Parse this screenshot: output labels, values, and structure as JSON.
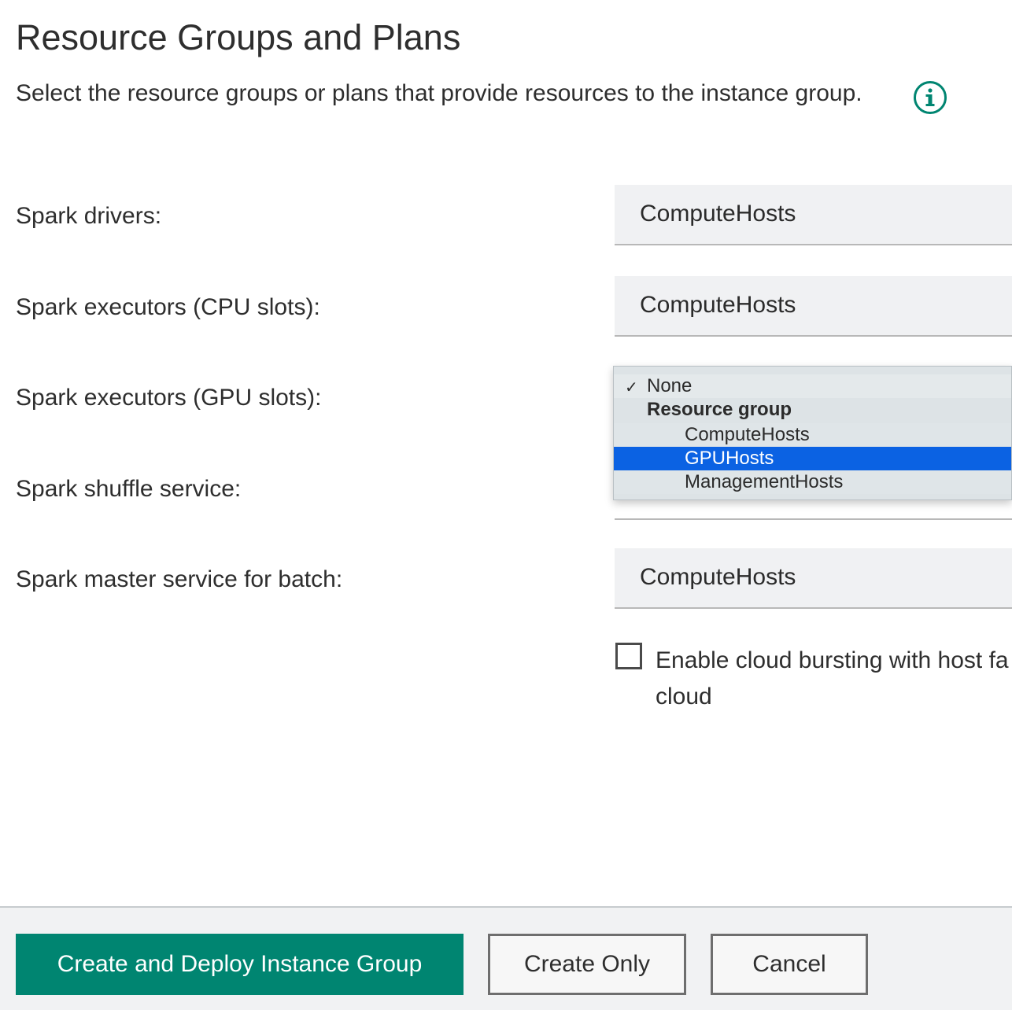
{
  "page": {
    "title": "Resource Groups and Plans",
    "subtitle": "Select the resource groups or plans that provide resources to the instance group."
  },
  "rows": [
    {
      "label": "Spark drivers:",
      "value": "ComputeHosts"
    },
    {
      "label": "Spark executors (CPU slots):",
      "value": "ComputeHosts"
    },
    {
      "label": "Spark executors (GPU slots):",
      "value": ""
    },
    {
      "label": "Spark shuffle service:",
      "value": ""
    },
    {
      "label": "Spark master service for batch:",
      "value": "ComputeHosts"
    }
  ],
  "dropdown": {
    "none_label": "None",
    "check_mark": "✓",
    "group_label": "Resource group",
    "options": [
      "ComputeHosts",
      "GPUHosts",
      "ManagementHosts"
    ],
    "selected": "GPUHosts"
  },
  "cloud_bursting": {
    "label": "Enable cloud bursting with host fa cloud",
    "checked": false
  },
  "buttons": {
    "primary": "Create and Deploy Instance Group",
    "create_only": "Create Only",
    "cancel": "Cancel"
  },
  "colors": {
    "primary_button": "#008571",
    "info_icon": "#008571",
    "selected_option": "#0b62e3"
  }
}
